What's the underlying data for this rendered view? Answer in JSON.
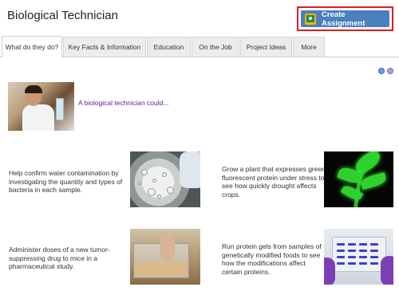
{
  "page": {
    "title": "Biological Technician"
  },
  "toolbar": {
    "create_assignment_label": "Create Assignment"
  },
  "tabs": [
    {
      "label": "What do they do?",
      "active": true
    },
    {
      "label": "Key Facts & Information",
      "active": false
    },
    {
      "label": "Education",
      "active": false
    },
    {
      "label": "On the Job",
      "active": false
    },
    {
      "label": "Project Ideas",
      "active": false
    },
    {
      "label": "More",
      "active": false
    }
  ],
  "intro": {
    "text": "A biological technician could..."
  },
  "tasks": [
    {
      "text": "Help confirm water contamination by investigating the quantity and types of bacteria in each sample.",
      "image": "petri-dish-photo"
    },
    {
      "text": "Grow a plant that expresses green fluorescent protein under stress to see how quickly drought affects crops.",
      "image": "fluorescent-plant-photo"
    },
    {
      "text": "Administer doses of a new tumor-suppressing drug to mice in a pharmaceutical study.",
      "image": "lab-mice-photo"
    },
    {
      "text": "Run protein gels from samples of genetically modified foods to see how the modifications affect certain proteins.",
      "image": "protein-gel-photo"
    }
  ],
  "colors": {
    "accent_button": "#4a7fc0",
    "highlight_border": "#e01b1b",
    "intro_link": "#5a1e9a"
  },
  "icons": [
    "google-classroom-icon",
    "share-icon",
    "email-icon"
  ]
}
